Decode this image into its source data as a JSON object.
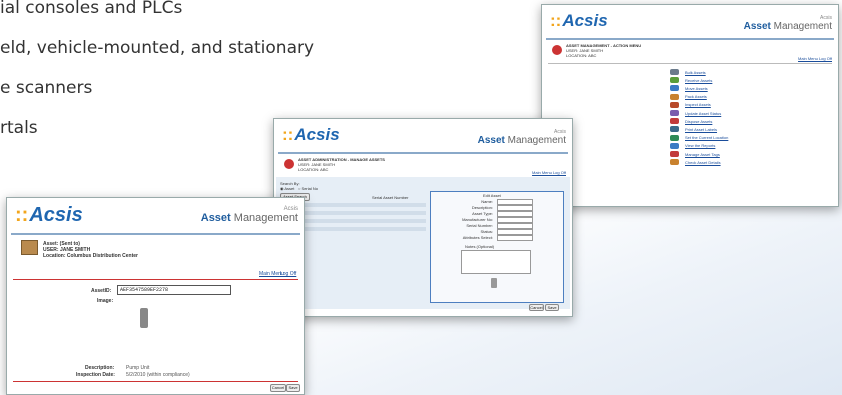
{
  "bullets": [
    "ial consoles and PLCs",
    "eld, vehicle-mounted, and stationary",
    "e scanners",
    "rtals"
  ],
  "brand": {
    "logo": "Acsis",
    "company": "Acsis",
    "product_bold": "Asset",
    "product_rest": "Management",
    "colors": {
      "logo": "#1f66b0",
      "dots": "#f2a51c",
      "title": "#1f5d9e"
    }
  },
  "screen_menu": {
    "header_title": "ASSET MANAGEMENT - ACTION MENU",
    "header_user": "USER: JANE SMITH",
    "header_loc": "LOCATION: ABC",
    "top_links": "Main Menu  Log Off",
    "items": [
      {
        "label": "Bulk Assets",
        "icon": "scanner-icon",
        "color": "#6b7b8c"
      },
      {
        "label": "Receive Assets",
        "icon": "receive-icon",
        "color": "#5a9e3a"
      },
      {
        "label": "Move Assets",
        "icon": "move-icon",
        "color": "#3b7bc4"
      },
      {
        "label": "Pack Assets",
        "icon": "box-icon",
        "color": "#c9822e"
      },
      {
        "label": "Inspect Assets",
        "icon": "inspect-icon",
        "color": "#b84a2a"
      },
      {
        "label": "Update Asset Status",
        "icon": "update-icon",
        "color": "#7a5cae"
      },
      {
        "label": "Dispose Assets",
        "icon": "dispose-icon",
        "color": "#c23b3b"
      },
      {
        "label": "Print Asset Labels",
        "icon": "printer-icon",
        "color": "#3a6a8a"
      },
      {
        "label": "Set the Current Location",
        "icon": "location-icon",
        "color": "#2e8b57"
      },
      {
        "label": "View the Reports",
        "icon": "reports-icon",
        "color": "#3b7bc4"
      },
      {
        "label": "Manage Asset Tags",
        "icon": "tag-icon",
        "color": "#c23b3b"
      },
      {
        "label": "Check Asset Details",
        "icon": "details-icon",
        "color": "#c9822e"
      }
    ]
  },
  "screen_search": {
    "header_title": "ASSET ADMINISTRATION - MANAGE ASSETS",
    "header_user": "USER: JANE SMITH",
    "header_loc": "LOCATION: ABC",
    "top_links": "Main Menu  Log Off",
    "radio_label": "Search By:",
    "radio_1": "Asset",
    "radio_2": "Serial No",
    "search_button": "Asset Search",
    "serial_label": "Serial Asset Number",
    "panel_title": "Edit Asset",
    "fields": [
      {
        "label": "Name:",
        "value": ""
      },
      {
        "label": "Description:",
        "value": ""
      },
      {
        "label": "Asset Type:",
        "value": ""
      },
      {
        "label": "Manufacturer No:",
        "value": ""
      },
      {
        "label": "Serial Number:",
        "value": ""
      },
      {
        "label": "Status:",
        "value": ""
      },
      {
        "label": "Attributes Select:",
        "value": ""
      }
    ],
    "notes_label": "Notes (Optional)",
    "cancel": "Cancel",
    "save": "Save"
  },
  "screen_detail": {
    "header_title": "Asset: (Sent to)",
    "header_user": "USER: JANE SMITH",
    "header_loc": "Location: Columbus Distribution Center",
    "main_menu": "Main Menu",
    "log_off": "Log Off",
    "asset_id_label": "AssetID:",
    "asset_id_value": "AEF3547589EF2278",
    "image_label": "Image:",
    "description_label": "Description:",
    "description_value": "Pump Unit",
    "inspection_label": "Inspection Date:",
    "inspection_value": "5/2/2010 (within compliance)",
    "cancel": "Cancel",
    "save": "Save"
  }
}
